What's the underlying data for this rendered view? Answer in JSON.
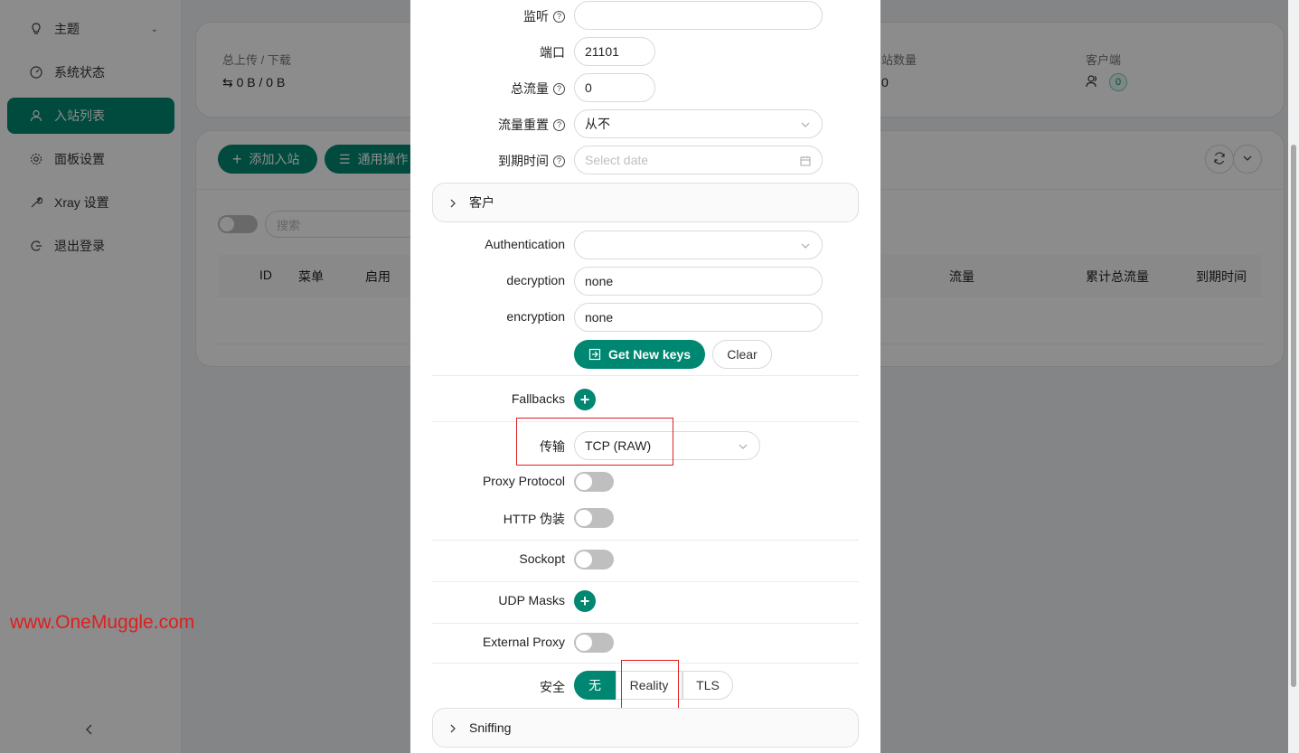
{
  "sidebar": {
    "items": [
      {
        "label": "主题",
        "icon": "bulb-icon"
      },
      {
        "label": "系统状态",
        "icon": "dashboard-icon"
      },
      {
        "label": "入站列表",
        "icon": "user-icon"
      },
      {
        "label": "面板设置",
        "icon": "gear-icon"
      },
      {
        "label": "Xray 设置",
        "icon": "tool-icon"
      },
      {
        "label": "退出登录",
        "icon": "logout-icon"
      }
    ],
    "active_index": 2
  },
  "stats": {
    "traffic_label": "总上传 / 下载",
    "traffic_value": "⇆ 0 B / 0 B",
    "inbound_count_label": "站数量",
    "inbound_count_value": "0",
    "clients_label": "客户端",
    "clients_value": "0"
  },
  "toolbar": {
    "add_inbound": "添加入站",
    "general_actions": "通用操作"
  },
  "search": {
    "placeholder": "搜索"
  },
  "table": {
    "headers": [
      "ID",
      "菜单",
      "启用",
      "流量",
      "累计总流量",
      "到期时间"
    ]
  },
  "modal": {
    "listen_label": "监听",
    "listen_value": "",
    "port_label": "端口",
    "port_value": "21101",
    "total_traffic_label": "总流量",
    "total_traffic_value": "0",
    "traffic_reset_label": "流量重置",
    "traffic_reset_value": "从不",
    "expiry_label": "到期时间",
    "expiry_placeholder": "Select date",
    "clients_panel": "客户",
    "authentication_label": "Authentication",
    "authentication_value": "",
    "decryption_label": "decryption",
    "decryption_value": "none",
    "encryption_label": "encryption",
    "encryption_value": "none",
    "get_new_keys": "Get New keys",
    "clear": "Clear",
    "fallbacks_label": "Fallbacks",
    "transport_label": "传输",
    "transport_value": "TCP (RAW)",
    "proxy_protocol_label": "Proxy Protocol",
    "http_camouflage_label": "HTTP 伪装",
    "sockopt_label": "Sockopt",
    "udp_masks_label": "UDP Masks",
    "external_proxy_label": "External Proxy",
    "security_label": "安全",
    "security_options": [
      "无",
      "Reality",
      "TLS"
    ],
    "security_selected": "无",
    "sniffing_panel": "Sniffing"
  },
  "watermark": "www.OneMuggle.com",
  "colors": {
    "accent": "#008771",
    "highlight_box": "#e02020",
    "watermark": "#e11d1d"
  }
}
